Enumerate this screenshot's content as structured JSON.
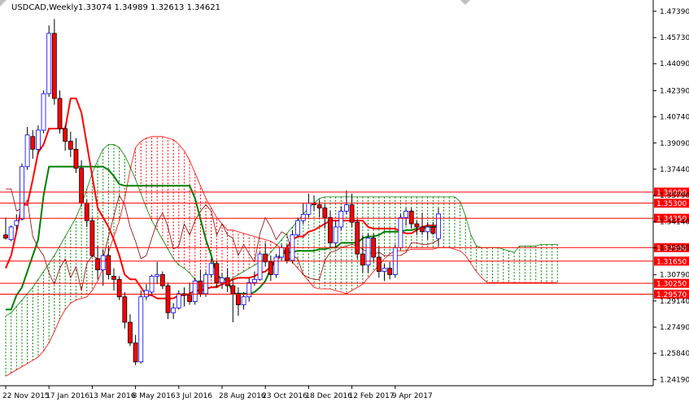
{
  "chart_data": {
    "type": "candlestick",
    "title": "USDCAD,Weekly",
    "ohlc": [
      "1.33074",
      "1.34989",
      "1.32613",
      "1.34621"
    ],
    "ylim": [
      1.238,
      1.481
    ],
    "y_ticks": [
      "1.47390",
      "1.45730",
      "1.44090",
      "1.42390",
      "1.40740",
      "1.39090",
      "1.37440",
      "1.35790",
      "1.34140",
      "1.32480",
      "1.30790",
      "1.29140",
      "1.27490",
      "1.25840",
      "1.24190"
    ],
    "x_tick_labels": [
      {
        "i": 0,
        "label": "22 Nov 2015"
      },
      {
        "i": 8,
        "label": "17 Jan 2016"
      },
      {
        "i": 16,
        "label": "13 Mar 2016"
      },
      {
        "i": 24,
        "label": "8 May 2016"
      },
      {
        "i": 32,
        "label": "3 Jul 2016"
      },
      {
        "i": 40,
        "label": "28 Aug 2016"
      },
      {
        "i": 48,
        "label": "23 Oct 2016"
      },
      {
        "i": 56,
        "label": "18 Dec 2016"
      },
      {
        "i": 64,
        "label": "12 Feb 2017"
      },
      {
        "i": 72,
        "label": "9 Apr 2017"
      }
    ],
    "levels": [
      "1.36000",
      "1.35300",
      "1.34350",
      "1.32500",
      "1.31650",
      "1.30250",
      "1.29570"
    ],
    "candles": [
      [
        1.333,
        1.344,
        1.33,
        1.331
      ],
      [
        1.33,
        1.339,
        1.329,
        1.338
      ],
      [
        1.339,
        1.346,
        1.336,
        1.342
      ],
      [
        1.343,
        1.378,
        1.342,
        1.376
      ],
      [
        1.376,
        1.401,
        1.374,
        1.396
      ],
      [
        1.395,
        1.399,
        1.381,
        1.387
      ],
      [
        1.387,
        1.402,
        1.384,
        1.399
      ],
      [
        1.399,
        1.424,
        1.397,
        1.422
      ],
      [
        1.422,
        1.465,
        1.42,
        1.46
      ],
      [
        1.46,
        1.469,
        1.415,
        1.419
      ],
      [
        1.419,
        1.424,
        1.397,
        1.4
      ],
      [
        1.4,
        1.402,
        1.386,
        1.392
      ],
      [
        1.392,
        1.398,
        1.382,
        1.387
      ],
      [
        1.387,
        1.394,
        1.372,
        1.375
      ],
      [
        1.375,
        1.38,
        1.351,
        1.353
      ],
      [
        1.353,
        1.355,
        1.338,
        1.342
      ],
      [
        1.342,
        1.344,
        1.319,
        1.32
      ],
      [
        1.318,
        1.326,
        1.305,
        1.311
      ],
      [
        1.311,
        1.324,
        1.301,
        1.32
      ],
      [
        1.32,
        1.326,
        1.305,
        1.308
      ],
      [
        1.307,
        1.312,
        1.298,
        1.305
      ],
      [
        1.305,
        1.307,
        1.292,
        1.294
      ],
      [
        1.294,
        1.297,
        1.274,
        1.278
      ],
      [
        1.278,
        1.283,
        1.263,
        1.265
      ],
      [
        1.265,
        1.27,
        1.251,
        1.253
      ],
      [
        1.253,
        1.298,
        1.252,
        1.294
      ],
      [
        1.294,
        1.302,
        1.292,
        1.298
      ],
      [
        1.297,
        1.308,
        1.295,
        1.307
      ],
      [
        1.307,
        1.316,
        1.302,
        1.308
      ],
      [
        1.308,
        1.31,
        1.299,
        1.301
      ],
      [
        1.301,
        1.303,
        1.28,
        1.284
      ],
      [
        1.284,
        1.29,
        1.28,
        1.287
      ],
      [
        1.287,
        1.298,
        1.286,
        1.296
      ],
      [
        1.296,
        1.3,
        1.288,
        1.295
      ],
      [
        1.295,
        1.303,
        1.289,
        1.291
      ],
      [
        1.291,
        1.306,
        1.289,
        1.304
      ],
      [
        1.304,
        1.311,
        1.294,
        1.296
      ],
      [
        1.296,
        1.31,
        1.294,
        1.308
      ],
      [
        1.308,
        1.318,
        1.306,
        1.315
      ],
      [
        1.315,
        1.317,
        1.3,
        1.303
      ],
      [
        1.303,
        1.309,
        1.299,
        1.306
      ],
      [
        1.306,
        1.312,
        1.297,
        1.301
      ],
      [
        1.301,
        1.305,
        1.278,
        1.296
      ],
      [
        1.296,
        1.3,
        1.282,
        1.289
      ],
      [
        1.289,
        1.297,
        1.286,
        1.294
      ],
      [
        1.294,
        1.306,
        1.291,
        1.303
      ],
      [
        1.303,
        1.31,
        1.301,
        1.305
      ],
      [
        1.305,
        1.322,
        1.304,
        1.321
      ],
      [
        1.321,
        1.328,
        1.313,
        1.316
      ],
      [
        1.316,
        1.32,
        1.304,
        1.308
      ],
      [
        1.308,
        1.321,
        1.306,
        1.319
      ],
      [
        1.319,
        1.327,
        1.317,
        1.325
      ],
      [
        1.325,
        1.327,
        1.315,
        1.317
      ],
      [
        1.317,
        1.336,
        1.315,
        1.333
      ],
      [
        1.333,
        1.344,
        1.332,
        1.342
      ],
      [
        1.342,
        1.353,
        1.34,
        1.346
      ],
      [
        1.346,
        1.359,
        1.344,
        1.353
      ],
      [
        1.353,
        1.358,
        1.348,
        1.352
      ],
      [
        1.352,
        1.355,
        1.344,
        1.35
      ],
      [
        1.35,
        1.352,
        1.337,
        1.344
      ],
      [
        1.344,
        1.348,
        1.325,
        1.328
      ],
      [
        1.328,
        1.342,
        1.325,
        1.338
      ],
      [
        1.338,
        1.351,
        1.336,
        1.348
      ],
      [
        1.348,
        1.361,
        1.346,
        1.352
      ],
      [
        1.352,
        1.359,
        1.338,
        1.341
      ],
      [
        1.341,
        1.343,
        1.318,
        1.321
      ],
      [
        1.321,
        1.333,
        1.309,
        1.314
      ],
      [
        1.314,
        1.334,
        1.309,
        1.331
      ],
      [
        1.331,
        1.334,
        1.316,
        1.319
      ],
      [
        1.319,
        1.326,
        1.306,
        1.31
      ],
      [
        1.31,
        1.315,
        1.304,
        1.312
      ],
      [
        1.312,
        1.316,
        1.305,
        1.308
      ],
      [
        1.308,
        1.327,
        1.306,
        1.325
      ],
      [
        1.325,
        1.346,
        1.324,
        1.344
      ],
      [
        1.344,
        1.35,
        1.339,
        1.348
      ],
      [
        1.348,
        1.35,
        1.337,
        1.34
      ],
      [
        1.34,
        1.342,
        1.333,
        1.338
      ],
      [
        1.338,
        1.347,
        1.333,
        1.335
      ],
      [
        1.335,
        1.341,
        1.33,
        1.338
      ],
      [
        1.338,
        1.341,
        1.333,
        1.334
      ],
      [
        1.3307,
        1.3499,
        1.3261,
        1.3462
      ]
    ],
    "tenkan": [
      1.312,
      1.32,
      1.335,
      1.352,
      1.352,
      1.368,
      1.385,
      1.39,
      1.4,
      1.4,
      1.4,
      1.4,
      1.419,
      1.419,
      1.41,
      1.39,
      1.37,
      1.35,
      1.344,
      1.338,
      1.33,
      1.32,
      1.308,
      1.305,
      1.305,
      1.3,
      1.295,
      1.295,
      1.293,
      1.293,
      1.293,
      1.293,
      1.295,
      1.295,
      1.296,
      1.298,
      1.298,
      1.299,
      1.3,
      1.3,
      1.302,
      1.303,
      1.305,
      1.306,
      1.306,
      1.306,
      1.307,
      1.309,
      1.31,
      1.313,
      1.317,
      1.32,
      1.325,
      1.33,
      1.332,
      1.332,
      1.335,
      1.336,
      1.338,
      1.34,
      1.342,
      1.342,
      1.342,
      1.342,
      1.342,
      1.342,
      1.342,
      1.338,
      1.337,
      1.337,
      1.337,
      1.337,
      1.337,
      1.335,
      1.334,
      1.334,
      1.336,
      1.338,
      1.339,
      1.339,
      1.339
    ],
    "kijun": [
      1.286,
      1.286,
      1.295,
      1.3,
      1.31,
      1.32,
      1.33,
      1.358,
      1.376,
      1.376,
      1.376,
      1.376,
      1.376,
      1.376,
      1.376,
      1.376,
      1.376,
      1.376,
      1.376,
      1.374,
      1.37,
      1.365,
      1.364,
      1.364,
      1.364,
      1.364,
      1.364,
      1.364,
      1.364,
      1.364,
      1.364,
      1.364,
      1.364,
      1.364,
      1.364,
      1.356,
      1.343,
      1.33,
      1.32,
      1.308,
      1.305,
      1.305,
      1.296,
      1.296,
      1.296,
      1.296,
      1.297,
      1.3,
      1.304,
      1.312,
      1.318,
      1.321,
      1.322,
      1.322,
      1.323,
      1.323,
      1.323,
      1.323,
      1.324,
      1.324,
      1.325,
      1.325,
      1.328,
      1.328,
      1.328,
      1.328,
      1.331,
      1.332,
      1.332,
      1.333,
      1.335,
      1.335,
      1.335,
      1.335,
      1.336,
      1.336,
      1.337,
      1.337,
      1.338,
      1.338,
      1.338
    ],
    "span_a": [
      1.282,
      1.284,
      1.288,
      1.292,
      1.296,
      1.3,
      1.305,
      1.31,
      1.315,
      1.32,
      1.326,
      1.332,
      1.338,
      1.344,
      1.352,
      1.362,
      1.372,
      1.38,
      1.387,
      1.39,
      1.39,
      1.388,
      1.383,
      1.376,
      1.368,
      1.359,
      1.35,
      1.342,
      1.336,
      1.33,
      1.324,
      1.318,
      1.314,
      1.312,
      1.309,
      1.305,
      1.302,
      1.3,
      1.3,
      1.301,
      1.302,
      1.303,
      1.306,
      1.308,
      1.31,
      1.312,
      1.314,
      1.316,
      1.318,
      1.322,
      1.326,
      1.33,
      1.334,
      1.338,
      1.342,
      1.346,
      1.35,
      1.353,
      1.356,
      1.357,
      1.357,
      1.357,
      1.357,
      1.357,
      1.357,
      1.357,
      1.357,
      1.357,
      1.357,
      1.357,
      1.357,
      1.357,
      1.357,
      1.357,
      1.357,
      1.357,
      1.357,
      1.357,
      1.357,
      1.357,
      1.357,
      1.357,
      1.357,
      1.357,
      1.354,
      1.345,
      1.333,
      1.326,
      1.325,
      1.325,
      1.325,
      1.325,
      1.324,
      1.323,
      1.322,
      1.326,
      1.326,
      1.326,
      1.326,
      1.327,
      1.327,
      1.327,
      1.327
    ],
    "span_b": [
      1.244,
      1.246,
      1.248,
      1.25,
      1.252,
      1.254,
      1.256,
      1.26,
      1.265,
      1.272,
      1.28,
      1.286,
      1.29,
      1.292,
      1.293,
      1.294,
      1.298,
      1.304,
      1.312,
      1.322,
      1.332,
      1.342,
      1.356,
      1.374,
      1.388,
      1.392,
      1.394,
      1.395,
      1.395,
      1.395,
      1.394,
      1.393,
      1.39,
      1.386,
      1.38,
      1.372,
      1.364,
      1.356,
      1.35,
      1.344,
      1.34,
      1.336,
      1.336,
      1.335,
      1.334,
      1.333,
      1.332,
      1.331,
      1.33,
      1.329,
      1.327,
      1.324,
      1.32,
      1.316,
      1.312,
      1.308,
      1.304,
      1.3,
      1.299,
      1.299,
      1.299,
      1.298,
      1.297,
      1.296,
      1.298,
      1.3,
      1.302,
      1.306,
      1.31,
      1.314,
      1.318,
      1.321,
      1.323,
      1.323,
      1.323,
      1.324,
      1.324,
      1.324,
      1.324,
      1.324,
      1.325,
      1.325,
      1.325,
      1.324,
      1.323,
      1.32,
      1.315,
      1.31,
      1.306,
      1.303,
      1.303,
      1.303,
      1.303,
      1.303,
      1.303,
      1.303,
      1.303,
      1.303,
      1.303,
      1.303,
      1.303,
      1.303,
      1.303
    ],
    "chikou": [
      1.362,
      1.362,
      1.348,
      1.35,
      1.355,
      1.332,
      1.325,
      1.32,
      1.309,
      1.302,
      1.312,
      1.318,
      1.306,
      1.313,
      1.298,
      1.315,
      1.32,
      1.318,
      1.318,
      1.332,
      1.345,
      1.358,
      1.352,
      1.338,
      1.329,
      1.318,
      1.32,
      1.331,
      1.341,
      1.347,
      1.338,
      1.324,
      1.326,
      1.34,
      1.333,
      1.342,
      1.348,
      1.352,
      1.348,
      1.333,
      1.34,
      1.333,
      1.331,
      1.32,
      1.327,
      1.321,
      1.316,
      1.334,
      1.344,
      1.338,
      1.33,
      1.335,
      1.333,
      1.32,
      1.318,
      1.308,
      1.306,
      1.305,
      1.305,
      1.317,
      1.322,
      1.323,
      1.325,
      1.326,
      1.327,
      1.326,
      1.324,
      1.322,
      1.321,
      1.322,
      1.32,
      1.32,
      1.32,
      1.32,
      1.322,
      1.328,
      1.328,
      1.327,
      1.327,
      1.328,
      1.33
    ],
    "chikou_start": 0,
    "colors": {
      "bull_border": "#0000ff",
      "bull_fill": "#ffffff",
      "bear_fill": "#ff0000",
      "wick": "#000000",
      "tenkan": "#ff0000",
      "kijun": "#008000",
      "chikou": "#8b0000",
      "cloud_up": "#008000",
      "cloud_down": "#ff0000",
      "level_line": "#ff0000",
      "level_box": "#ff0000",
      "axis": "#000000"
    }
  }
}
